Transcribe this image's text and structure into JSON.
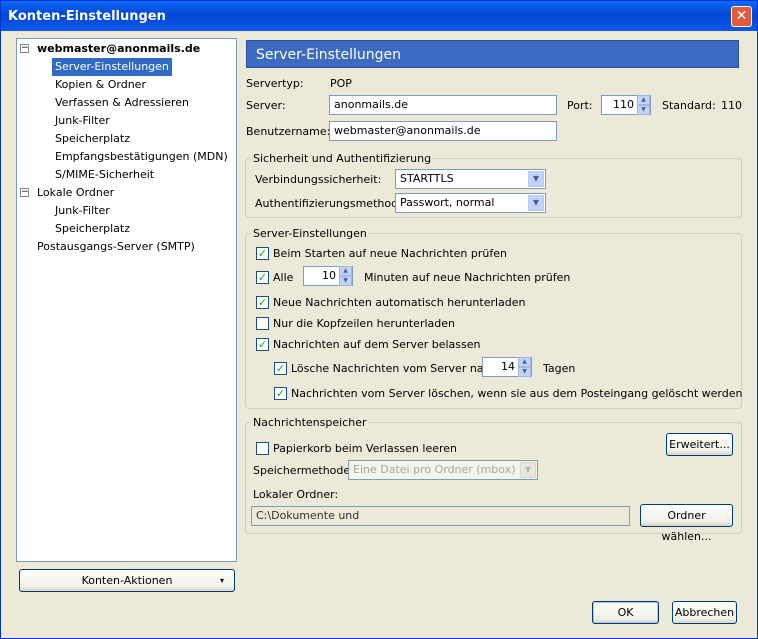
{
  "window": {
    "title": "Konten-Einstellungen",
    "close_glyph": "✕"
  },
  "tree": {
    "account": "webmaster@anonmails.de",
    "account_items": [
      "Server-Einstellungen",
      "Kopien & Ordner",
      "Verfassen & Adressieren",
      "Junk-Filter",
      "Speicherplatz",
      "Empfangsbestätigungen (MDN)",
      "S/MIME-Sicherheit"
    ],
    "local": "Lokale Ordner",
    "local_items": [
      "Junk-Filter",
      "Speicherplatz"
    ],
    "smtp": "Postausgangs-Server (SMTP)",
    "collapse_glyph": "−"
  },
  "account_actions": {
    "label": "Konten-Aktionen",
    "arrow": "▾"
  },
  "panel": {
    "header": "Server-Einstellungen",
    "servertype_label": "Servertyp:",
    "servertype_value": "POP",
    "server_label": "Server:",
    "server_value": "anonmails.de",
    "port_label": "Port:",
    "port_value": "110",
    "standard_label": "Standard:",
    "standard_value": "110",
    "user_label": "Benutzername:",
    "user_value": "webmaster@anonmails.de"
  },
  "security": {
    "legend": "Sicherheit und Authentifizierung",
    "conn_label": "Verbindungssicherheit:",
    "conn_value": "STARTTLS",
    "auth_label": "Authentifizierungsmethode:",
    "auth_value": "Passwort, normal"
  },
  "server_settings": {
    "legend": "Server-Einstellungen",
    "check_startup": "Beim Starten auf neue Nachrichten prüfen",
    "check_every": "Alle",
    "every_value": "10",
    "every_suffix": "Minuten auf neue Nachrichten prüfen",
    "auto_download": "Neue Nachrichten automatisch herunterladen",
    "headers_only": "Nur die Kopfzeilen herunterladen",
    "leave_on_server": "Nachrichten auf dem Server belassen",
    "delete_after": "Lösche Nachrichten vom Server nach",
    "delete_days": "14",
    "days_label": "Tagen",
    "delete_when_removed": "Nachrichten vom Server löschen, wenn sie aus dem Posteingang gelöscht werden",
    "checked": "✓"
  },
  "storage": {
    "legend": "Nachrichtenspeicher",
    "empty_trash": "Papierkorb beim Verlassen leeren",
    "advanced": "Erweitert...",
    "method_label": "Speichermethode:",
    "method_value": "Eine Datei pro Ordner (mbox)",
    "local_label": "Lokaler Ordner:",
    "local_value": "C:\\Dokumente und Einstellungen\\console\\Anwendungsdaten\\Thunderbird\\Pro",
    "choose": "Ordner wählen..."
  },
  "footer": {
    "ok": "OK",
    "cancel": "Abbrechen"
  }
}
